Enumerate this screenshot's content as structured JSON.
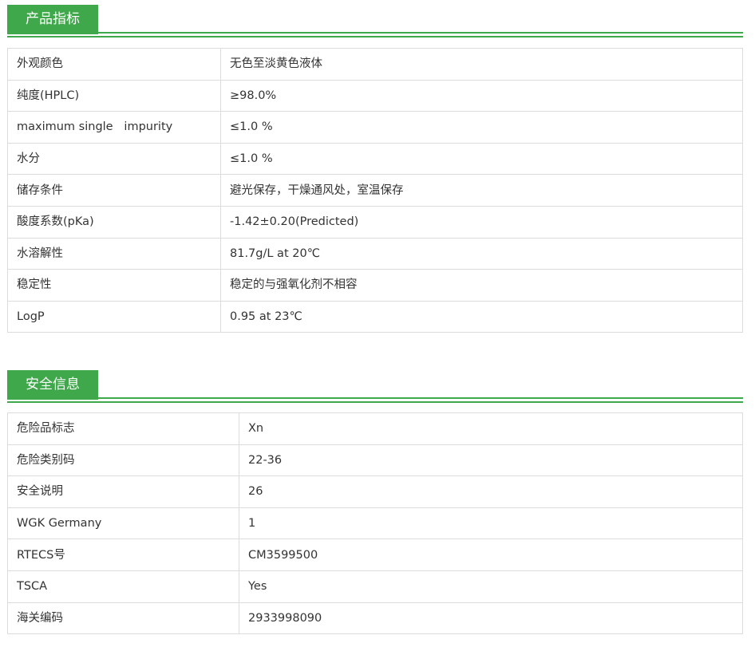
{
  "product_section": {
    "title": "产品指标",
    "rows": [
      {
        "label": "外观颜色",
        "value": "无色至淡黄色液体"
      },
      {
        "label": "纯度(HPLC)",
        "value": "≥98.0%"
      },
      {
        "label": "maximum single   impurity",
        "value": "≤1.0 %"
      },
      {
        "label": "水分",
        "value": "≤1.0 %"
      },
      {
        "label": "储存条件",
        "value": "避光保存，干燥通风处，室温保存"
      },
      {
        "label": "酸度系数(pKa)",
        "value": "-1.42±0.20(Predicted)"
      },
      {
        "label": "水溶解性",
        "value": "81.7g/L at 20℃"
      },
      {
        "label": "稳定性",
        "value": "稳定的与强氧化剂不相容"
      },
      {
        "label": "LogP",
        "value": "0.95 at 23℃"
      }
    ]
  },
  "safety_section": {
    "title": "安全信息",
    "rows": [
      {
        "label": "危险品标志",
        "value": "Xn"
      },
      {
        "label": "危险类别码",
        "value": "22-36"
      },
      {
        "label": "安全说明",
        "value": "26"
      },
      {
        "label": "WGK Germany",
        "value": "1"
      },
      {
        "label": "RTECS号",
        "value": "CM3599500"
      },
      {
        "label": "TSCA",
        "value": "Yes"
      },
      {
        "label": "海关编码",
        "value": "2933998090"
      }
    ]
  },
  "colors": {
    "accent": "#3fa84a",
    "border": "#dcdcdc",
    "text": "#333333"
  }
}
